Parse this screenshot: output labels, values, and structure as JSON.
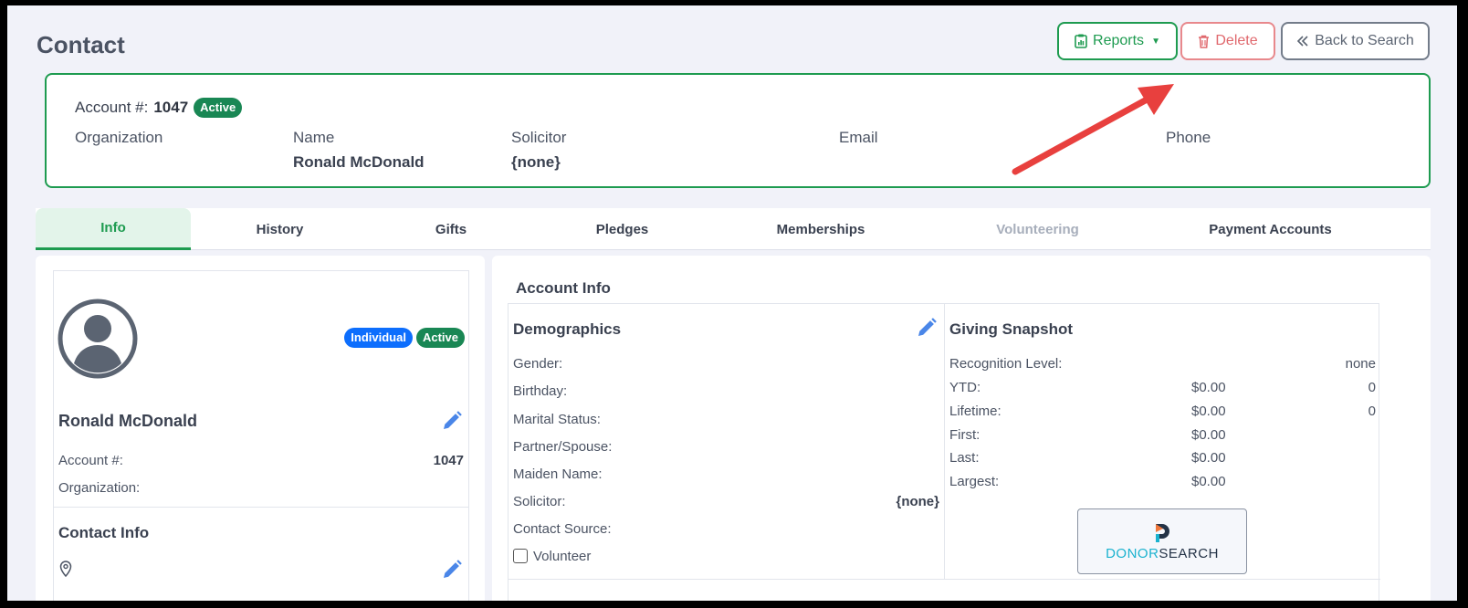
{
  "header": {
    "title": "Contact",
    "reports_label": "Reports",
    "delete_label": "Delete",
    "back_label": "Back to Search"
  },
  "account": {
    "label": "Account #:",
    "number": "1047",
    "status": "Active",
    "fields": [
      {
        "label": "Organization",
        "value": ""
      },
      {
        "label": "Name",
        "value": "Ronald McDonald"
      },
      {
        "label": "Solicitor",
        "value": "{none}"
      },
      {
        "label": "Email",
        "value": ""
      },
      {
        "label": "Phone",
        "value": ""
      }
    ]
  },
  "tabs": [
    {
      "label": "Info",
      "state": "active"
    },
    {
      "label": "History",
      "state": "normal"
    },
    {
      "label": "Gifts",
      "state": "normal"
    },
    {
      "label": "Pledges",
      "state": "normal"
    },
    {
      "label": "Memberships",
      "state": "normal"
    },
    {
      "label": "Volunteering",
      "state": "disabled"
    },
    {
      "label": "Payment Accounts",
      "state": "normal"
    }
  ],
  "profile": {
    "type_badge": "Individual",
    "status_badge": "Active",
    "name": "Ronald McDonald",
    "account_label": "Account #:",
    "account_value": "1047",
    "organization_label": "Organization:",
    "organization_value": "",
    "contact_info_title": "Contact Info"
  },
  "account_info": {
    "title": "Account Info",
    "demographics": {
      "title": "Demographics",
      "rows": [
        {
          "label": "Gender:",
          "value": ""
        },
        {
          "label": "Birthday:",
          "value": ""
        },
        {
          "label": "Marital Status:",
          "value": ""
        },
        {
          "label": "Partner/Spouse:",
          "value": ""
        },
        {
          "label": "Maiden Name:",
          "value": ""
        },
        {
          "label": "Solicitor:",
          "value": "{none}"
        },
        {
          "label": "Contact Source:",
          "value": ""
        }
      ],
      "volunteer_label": "Volunteer"
    },
    "giving": {
      "title": "Giving Snapshot",
      "recognition_label": "Recognition Level:",
      "recognition_value": "none",
      "rows": [
        {
          "label": "YTD:",
          "amount": "$0.00",
          "count": "0"
        },
        {
          "label": "Lifetime:",
          "amount": "$0.00",
          "count": "0"
        },
        {
          "label": "First:",
          "amount": "$0.00",
          "count": ""
        },
        {
          "label": "Last:",
          "amount": "$0.00",
          "count": ""
        },
        {
          "label": "Largest:",
          "amount": "$0.00",
          "count": ""
        }
      ],
      "donorsearch_part1": "DONOR",
      "donorsearch_part2": "SEARCH"
    }
  },
  "colors": {
    "accent_green": "#1e9b50",
    "badge_blue": "#0d6efd",
    "delete_red": "#e0686d",
    "arrow_red": "#e8403e",
    "edit_blue": "#4a86e8"
  }
}
